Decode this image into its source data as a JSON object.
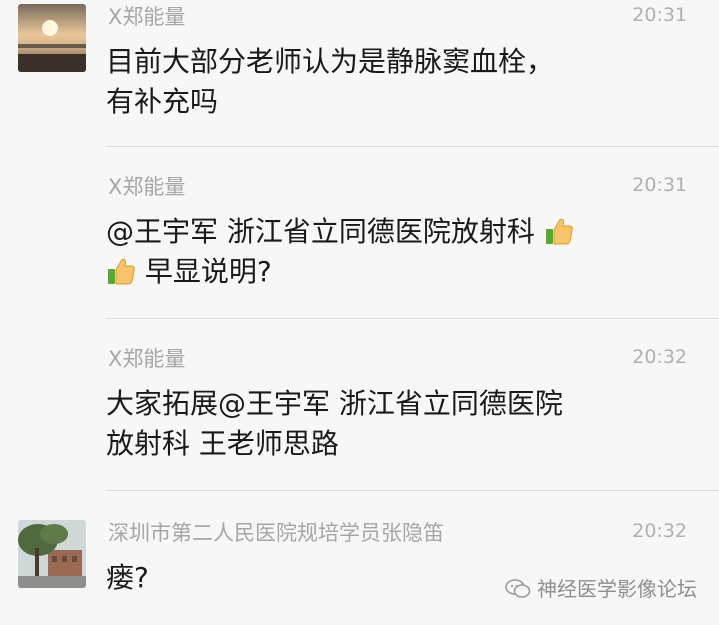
{
  "messages": [
    {
      "sender": "X郑能量",
      "time": "20:31",
      "avatar_icon": "sunset-avatar",
      "text": "目前大部分老师认为是静脉窦血栓，\n有补充吗"
    },
    {
      "sender": "X郑能量",
      "time": "20:31",
      "text_a": "@王宇军 浙江省立同德医院放射科",
      "text_b": "早显说明?",
      "emoji": "thumbs-up-icon"
    },
    {
      "sender": "X郑能量",
      "time": "20:32",
      "text": "大家拓展@王宇军 浙江省立同德医院\n放射科 王老师思路"
    },
    {
      "sender": "深圳市第二人民医院规培学员张隐笛",
      "time": "20:32",
      "avatar_icon": "tree-building-avatar",
      "text": "瘘?"
    }
  ],
  "watermark": {
    "label": "神经医学影像论坛",
    "icon": "wechat-icon"
  }
}
